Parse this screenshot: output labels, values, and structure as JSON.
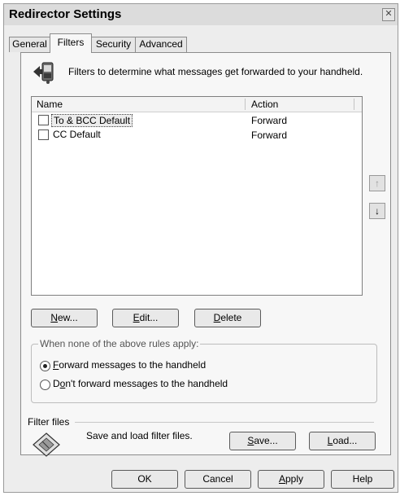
{
  "window": {
    "title": "Redirector Settings",
    "close_glyph": "✕"
  },
  "tabs": [
    {
      "label": "General"
    },
    {
      "label": "Filters"
    },
    {
      "label": "Security"
    },
    {
      "label": "Advanced"
    }
  ],
  "filters_panel": {
    "description": "Filters to determine what messages get forwarded to your handheld.",
    "icon": "handheld-forward-icon",
    "list": {
      "columns": {
        "name": "Name",
        "action": "Action"
      },
      "rows": [
        {
          "name": "To & BCC Default",
          "action": "Forward",
          "checked": false,
          "selected": true
        },
        {
          "name": "CC Default",
          "action": "Forward",
          "checked": false,
          "selected": false
        }
      ]
    },
    "move_up_glyph": "↑",
    "move_down_glyph": "↓",
    "buttons": {
      "new": {
        "u": "N",
        "rest": "ew..."
      },
      "edit": {
        "u": "E",
        "rest": "dit..."
      },
      "delete": {
        "u": "D",
        "rest": "elete"
      }
    },
    "rules_group": {
      "legend": "When none of the above rules apply:",
      "options": [
        {
          "u": "F",
          "rest": "orward messages to the handheld",
          "selected": true
        },
        {
          "pre": "D",
          "u": "o",
          "rest": "n't forward messages to the handheld",
          "selected": false
        }
      ]
    },
    "filter_files": {
      "label": "Filter files",
      "description": "Save and load filter files.",
      "icon": "floppy-disk-icon",
      "save": {
        "u": "S",
        "rest": "ave..."
      },
      "load": {
        "u": "L",
        "rest": "oad..."
      }
    }
  },
  "footer": {
    "ok": "OK",
    "cancel": "Cancel",
    "apply": {
      "u": "A",
      "rest": "pply"
    },
    "help": "Help"
  }
}
